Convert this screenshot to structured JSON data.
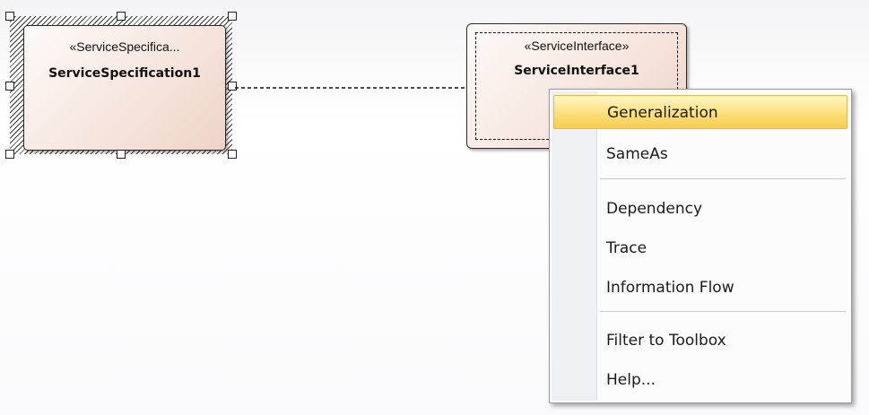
{
  "diagram": {
    "elements": [
      {
        "id": "service-specification",
        "stereotype": "«ServiceSpecifica...",
        "name": "ServiceSpecification1",
        "selected": true
      },
      {
        "id": "service-interface",
        "stereotype": "«ServiceInterface»",
        "name": "ServiceInterface1",
        "selected": false
      }
    ],
    "connector": {
      "style": "dashed"
    }
  },
  "context_menu": {
    "items": [
      {
        "label": "Generalization",
        "highlighted": true
      },
      {
        "label": "SameAs"
      },
      {
        "label": "Dependency"
      },
      {
        "label": "Trace"
      },
      {
        "label": "Information Flow"
      },
      {
        "label": "Filter to Toolbox"
      },
      {
        "label": "Help..."
      }
    ]
  },
  "colors": {
    "element_fill_light": "#fdfaf9",
    "element_fill_dark": "#eed3c7",
    "menu_highlight": "#fde07a",
    "menu_gutter": "#eff0f4"
  }
}
